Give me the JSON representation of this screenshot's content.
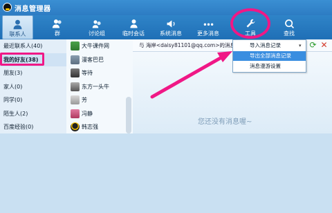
{
  "window": {
    "title": "消息管理器"
  },
  "toolbar": {
    "items": [
      {
        "label": "联系人",
        "icon": "person-icon"
      },
      {
        "label": "群",
        "icon": "group-icon"
      },
      {
        "label": "讨论组",
        "icon": "discussion-icon"
      },
      {
        "label": "临时会话",
        "icon": "temp-chat-icon"
      },
      {
        "label": "系统消息",
        "icon": "speaker-icon"
      },
      {
        "label": "更多消息",
        "icon": "more-icon"
      },
      {
        "label": "工具",
        "icon": "wrench-icon"
      },
      {
        "label": "查找",
        "icon": "search-icon"
      }
    ]
  },
  "sidebar": {
    "items": [
      {
        "label": "最近联系人(40)"
      },
      {
        "label": "我的好友(38)"
      },
      {
        "label": "朋友(3)"
      },
      {
        "label": "家人(0)"
      },
      {
        "label": "同学(0)"
      },
      {
        "label": "陌生人(2)"
      },
      {
        "label": "百度经验(0)"
      }
    ]
  },
  "contacts": {
    "items": [
      {
        "name": "大牛课件网"
      },
      {
        "name": "漫客巴巴"
      },
      {
        "name": "等待"
      },
      {
        "name": "东方一头牛"
      },
      {
        "name": "芳"
      },
      {
        "name": "冯静"
      },
      {
        "name": "韩志强"
      }
    ]
  },
  "main": {
    "path_text": "与 海岸<daisy81101@qq.com>的消息记",
    "empty_text": "您还没有消息喔~"
  },
  "dropdown": {
    "items": [
      {
        "label": "导入消息记录"
      },
      {
        "label": "导出全部消息记录"
      },
      {
        "label": "消息漫游设置"
      }
    ]
  },
  "colors": {
    "accent": "#2f84c8",
    "highlight": "#f01886",
    "menu_highlight": "#3a8ee0"
  }
}
